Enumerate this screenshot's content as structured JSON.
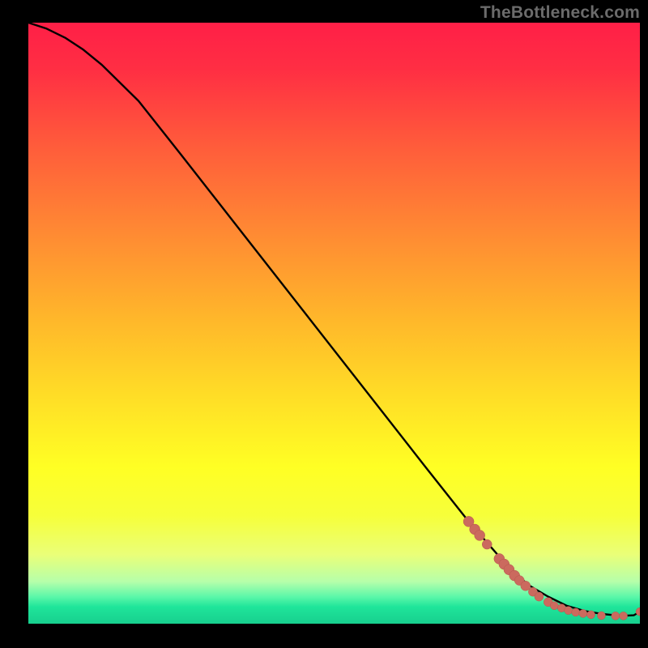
{
  "watermark": "TheBottleneck.com",
  "colors": {
    "accent_dot": "#cb6a5e",
    "curve": "#000000",
    "gradient_stops": [
      {
        "offset": 0.0,
        "color": "#ff1f47"
      },
      {
        "offset": 0.08,
        "color": "#ff2f43"
      },
      {
        "offset": 0.2,
        "color": "#ff5a3b"
      },
      {
        "offset": 0.35,
        "color": "#ff8a33"
      },
      {
        "offset": 0.5,
        "color": "#ffb92a"
      },
      {
        "offset": 0.63,
        "color": "#ffe026"
      },
      {
        "offset": 0.74,
        "color": "#ffff24"
      },
      {
        "offset": 0.82,
        "color": "#f6ff3a"
      },
      {
        "offset": 0.885,
        "color": "#eaff78"
      },
      {
        "offset": 0.93,
        "color": "#b6ffaa"
      },
      {
        "offset": 0.955,
        "color": "#5cf7a9"
      },
      {
        "offset": 0.972,
        "color": "#1fe59a"
      },
      {
        "offset": 1.0,
        "color": "#17cf8e"
      }
    ]
  },
  "chart_data": {
    "type": "line",
    "title": "",
    "xlabel": "",
    "ylabel": "",
    "xlim": [
      0,
      100
    ],
    "ylim": [
      0,
      100
    ],
    "grid": false,
    "series": [
      {
        "name": "bottleneck-curve",
        "x": [
          0,
          3,
          6,
          9,
          12,
          18,
          25,
          35,
          45,
          55,
          65,
          72,
          75,
          78,
          80,
          82,
          85,
          88,
          91,
          94,
          97,
          99,
          100
        ],
        "y": [
          100,
          99,
          97.5,
          95.5,
          93,
          87,
          78,
          65,
          52,
          39,
          26,
          17,
          13.5,
          10,
          8,
          6.3,
          4.5,
          3,
          2.1,
          1.6,
          1.3,
          1.4,
          2.0
        ]
      }
    ],
    "scatter": {
      "name": "highlighted-points",
      "points": [
        {
          "x": 72.0,
          "y": 17.0,
          "r": 6.5
        },
        {
          "x": 73.0,
          "y": 15.7,
          "r": 6.5
        },
        {
          "x": 73.8,
          "y": 14.7,
          "r": 6.5
        },
        {
          "x": 75.0,
          "y": 13.2,
          "r": 6.0
        },
        {
          "x": 77.0,
          "y": 10.8,
          "r": 6.5
        },
        {
          "x": 77.8,
          "y": 9.9,
          "r": 6.5
        },
        {
          "x": 78.6,
          "y": 9.0,
          "r": 6.5
        },
        {
          "x": 79.5,
          "y": 8.0,
          "r": 6.5
        },
        {
          "x": 80.3,
          "y": 7.2,
          "r": 6.0
        },
        {
          "x": 81.3,
          "y": 6.3,
          "r": 6.0
        },
        {
          "x": 82.5,
          "y": 5.3,
          "r": 5.5
        },
        {
          "x": 83.5,
          "y": 4.5,
          "r": 5.5
        },
        {
          "x": 85.0,
          "y": 3.6,
          "r": 5.5
        },
        {
          "x": 86.0,
          "y": 3.0,
          "r": 5.0
        },
        {
          "x": 87.2,
          "y": 2.6,
          "r": 5.0
        },
        {
          "x": 88.3,
          "y": 2.2,
          "r": 5.0
        },
        {
          "x": 89.5,
          "y": 1.9,
          "r": 5.0
        },
        {
          "x": 90.7,
          "y": 1.7,
          "r": 5.0
        },
        {
          "x": 92.0,
          "y": 1.5,
          "r": 5.0
        },
        {
          "x": 93.7,
          "y": 1.35,
          "r": 5.0
        },
        {
          "x": 96.0,
          "y": 1.3,
          "r": 5.0
        },
        {
          "x": 97.3,
          "y": 1.3,
          "r": 5.0
        },
        {
          "x": 100.0,
          "y": 2.0,
          "r": 5.0
        }
      ]
    }
  }
}
